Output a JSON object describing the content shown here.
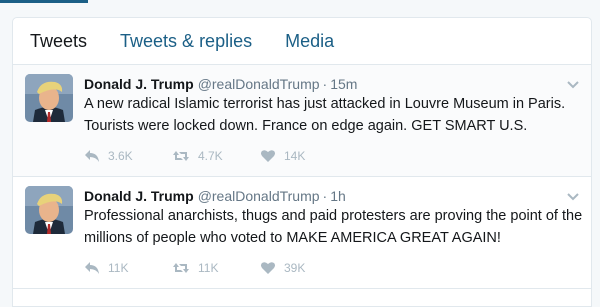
{
  "tabs": {
    "tweets": "Tweets",
    "replies": "Tweets & replies",
    "media": "Media"
  },
  "tweets": [
    {
      "name": "Donald J. Trump",
      "handle": "@realDonaldTrump",
      "separator": "·",
      "time": "15m",
      "text": "A new radical Islamic terrorist has just attacked in Louvre Museum in Paris. Tourists were locked down. France on edge again. GET SMART U.S.",
      "replies": "3.6K",
      "retweets": "4.7K",
      "likes": "14K"
    },
    {
      "name": "Donald J. Trump",
      "handle": "@realDonaldTrump",
      "separator": "·",
      "time": "1h",
      "text": "Professional anarchists, thugs and paid protesters are proving the point of the millions of people who voted to MAKE AMERICA GREAT AGAIN!",
      "replies": "11K",
      "retweets": "11K",
      "likes": "39K"
    }
  ],
  "icons": {
    "reply": "reply-icon",
    "retweet": "retweet-icon",
    "like": "heart-icon",
    "caret": "chevron-down-icon"
  },
  "colors": {
    "accent": "#1b5f86",
    "text": "#14171a",
    "muted": "#657786",
    "icon": "#aab8c2"
  }
}
